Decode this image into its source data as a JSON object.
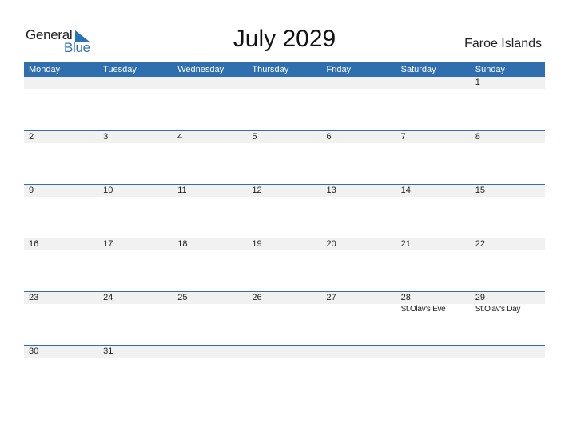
{
  "logo": {
    "word1": "General",
    "word2": "Blue"
  },
  "title": "July 2029",
  "country": "Faroe Islands",
  "colors": {
    "accent": "#2f6fb0",
    "strip": "#f1f1f1"
  },
  "weekdays": [
    "Monday",
    "Tuesday",
    "Wednesday",
    "Thursday",
    "Friday",
    "Saturday",
    "Sunday"
  ],
  "weeks": [
    [
      {
        "d": ""
      },
      {
        "d": ""
      },
      {
        "d": ""
      },
      {
        "d": ""
      },
      {
        "d": ""
      },
      {
        "d": ""
      },
      {
        "d": "1"
      }
    ],
    [
      {
        "d": "2"
      },
      {
        "d": "3"
      },
      {
        "d": "4"
      },
      {
        "d": "5"
      },
      {
        "d": "6"
      },
      {
        "d": "7"
      },
      {
        "d": "8"
      }
    ],
    [
      {
        "d": "9"
      },
      {
        "d": "10"
      },
      {
        "d": "11"
      },
      {
        "d": "12"
      },
      {
        "d": "13"
      },
      {
        "d": "14"
      },
      {
        "d": "15"
      }
    ],
    [
      {
        "d": "16"
      },
      {
        "d": "17"
      },
      {
        "d": "18"
      },
      {
        "d": "19"
      },
      {
        "d": "20"
      },
      {
        "d": "21"
      },
      {
        "d": "22"
      }
    ],
    [
      {
        "d": "23"
      },
      {
        "d": "24"
      },
      {
        "d": "25"
      },
      {
        "d": "26"
      },
      {
        "d": "27"
      },
      {
        "d": "28",
        "h": "St.Olav's Eve"
      },
      {
        "d": "29",
        "h": "St.Olav's Day"
      }
    ],
    [
      {
        "d": "30"
      },
      {
        "d": "31"
      },
      {
        "d": ""
      },
      {
        "d": ""
      },
      {
        "d": ""
      },
      {
        "d": ""
      },
      {
        "d": ""
      }
    ]
  ]
}
